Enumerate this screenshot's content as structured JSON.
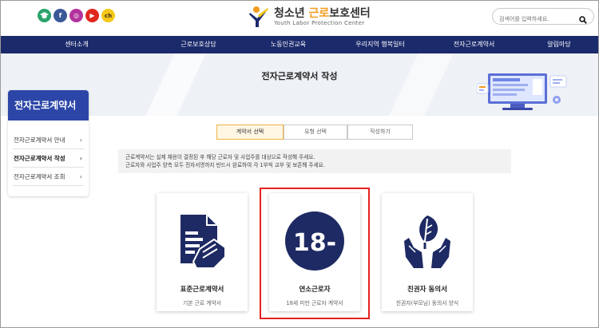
{
  "header": {
    "logo_main_prefix": "청소년 ",
    "logo_main_accent": "근로",
    "logo_main_suffix": "보호센터",
    "logo_sub": "Youth Labor Protection Center",
    "search": {
      "placeholder": "검색어를 입력하세요."
    },
    "sns": [
      {
        "icon": "cap-icon",
        "glyph": "",
        "color": "#2aa36b"
      },
      {
        "icon": "facebook-icon",
        "glyph": "f",
        "color": "#3b5998"
      },
      {
        "icon": "instagram-icon",
        "glyph": "◎",
        "color": "#b3339c"
      },
      {
        "icon": "youtube-icon",
        "glyph": "▶",
        "color": "#e0281f"
      },
      {
        "icon": "kakao-channel-icon",
        "glyph": "ch",
        "color": "#f6c818"
      }
    ]
  },
  "nav": {
    "items": [
      "센터소개",
      "근로보호상담",
      "노동인권교육",
      "우리지역 행복일터",
      "전자근로계약서",
      "알림마당"
    ]
  },
  "banner": {
    "title": "전자근로계약서 작성"
  },
  "sidebar": {
    "title": "전자근로계약서",
    "items": [
      {
        "label": "전자근로계약서 안내",
        "active": false
      },
      {
        "label": "전자근로계약서 작성",
        "active": true
      },
      {
        "label": "전자근로계약서 조회",
        "active": false
      }
    ],
    "chevron": "›"
  },
  "steps": [
    {
      "label": "계약서 선택",
      "active": true
    },
    {
      "label": "유형 선택",
      "active": false
    },
    {
      "label": "작성하기",
      "active": false
    }
  ],
  "notice": {
    "lines": [
      "근로계약서는 실제 채용이 결정된 후 해당 근로자 및 사업주를 대상으로 작성해 주세요.",
      "근로자와 사업주 양측 모두 전자서명까지 반드시 완료하여 각 1부씩 교부 및 보존해 주세요."
    ]
  },
  "cards": [
    {
      "title": "표준근로계약서",
      "desc": "기본 근로 계약서",
      "icon": "document-hand-icon"
    },
    {
      "title": "연소근로자",
      "desc": "18세 미만 근로자 계약서",
      "icon": "age-18-minus-icon",
      "badge": "18-"
    },
    {
      "title": "친권자 동의서",
      "desc": "친권자(부모님) 동의서 양식",
      "icon": "hands-leaf-icon"
    }
  ],
  "colors": {
    "navy": "#1b2a6b",
    "sidebar_blue": "#2c46a8",
    "accent_orange": "#f29a1d",
    "icon_navy": "#1e2a63",
    "highlight_red": "#e52020"
  }
}
